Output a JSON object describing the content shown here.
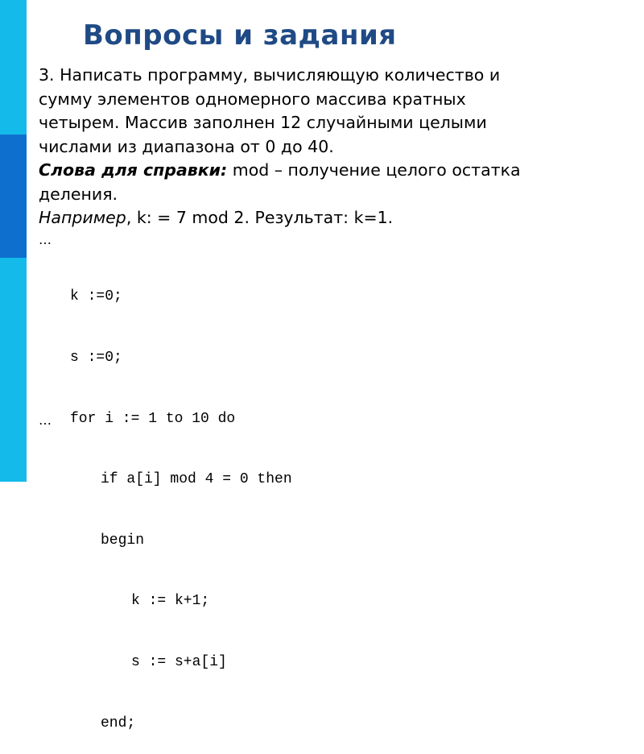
{
  "slide": {
    "title": "Вопросы и задания",
    "colors": {
      "stripe": "#14bbea",
      "stripe_accent": "#0f6fcf",
      "title": "#1f4a85"
    },
    "task": {
      "line1": "3. Написать программу, вычисляющую количество и",
      "line2": "сумму элементов одномерного массива кратных",
      "line3": "четырем. Массив заполнен 12 случайными целыми",
      "line4": "числами из диапазона от 0 до 40."
    },
    "hint": {
      "label": "Слова для справки:",
      "text": " mod – получение целого остатка",
      "text2": "деления."
    },
    "example": {
      "label": "Например",
      "text": ", k: = 7 mod 2. Результат: k=1."
    },
    "ellipsis_top": "…",
    "code_lines": [
      "k :=0;",
      "s :=0;",
      "for i := 1 to 10 do",
      "if a[i] mod 4 = 0 then",
      "begin",
      "k := k+1;",
      "s := s+a[i]",
      "end;"
    ],
    "ellipsis_bottom": "…"
  }
}
